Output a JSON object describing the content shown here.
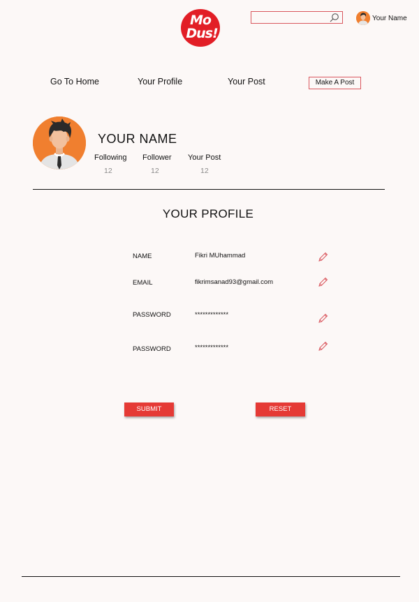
{
  "header": {
    "logo_line1": "Mo",
    "logo_line2": "Dus!",
    "search_placeholder": "",
    "user_name": "Your Name"
  },
  "nav": {
    "home": "Go To Home",
    "profile": "Your Profile",
    "post": "Your Post",
    "make_post": "Make A Post"
  },
  "profile": {
    "name": "YOUR NAME",
    "stats": [
      {
        "label": "Following",
        "value": "12"
      },
      {
        "label": "Follower",
        "value": "12"
      },
      {
        "label": "Your Post",
        "value": "12"
      }
    ]
  },
  "form": {
    "title": "YOUR PROFILE",
    "fields": [
      {
        "label": "NAME",
        "value": "Fikri MUhammad"
      },
      {
        "label": "EMAIL",
        "value": "fikrimsanad93@gmail.com"
      },
      {
        "label": "PASSWORD",
        "value": "*************"
      },
      {
        "label": "PASSWORD",
        "value": "*************"
      }
    ],
    "submit": "SUBMIT",
    "reset": "RESET"
  },
  "colors": {
    "accent": "#e53a35",
    "outline": "#d9565d",
    "background": "#fcf8f7",
    "avatar_bg": "#f07f2f"
  },
  "icons": [
    "search-icon",
    "pencil-icon",
    "avatar"
  ]
}
